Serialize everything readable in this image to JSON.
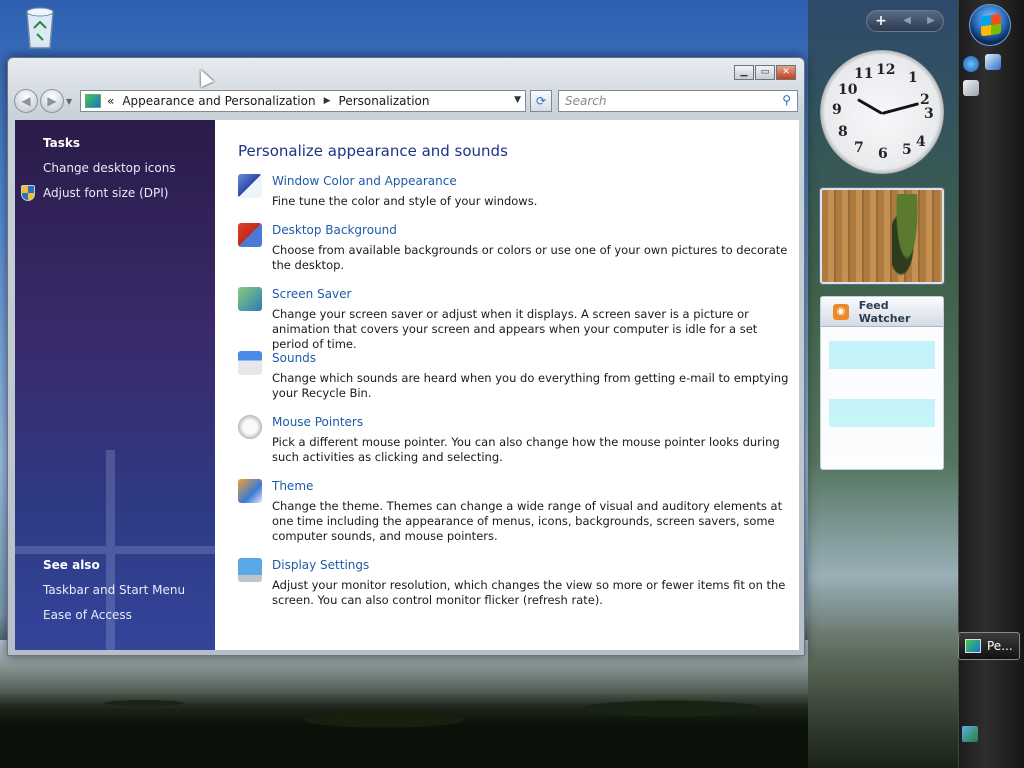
{
  "desktop": {
    "recycle_bin_icon": "recycle-bin-icon"
  },
  "window": {
    "address": {
      "prefix": "«",
      "crumb1": "Appearance and Personalization",
      "crumb2": "Personalization"
    },
    "search_placeholder": "Search",
    "captions": {
      "minimize": "▁",
      "maximize": "▭",
      "close": "✕"
    }
  },
  "left_pane": {
    "tasks_heading": "Tasks",
    "tasks": [
      "Change desktop icons",
      "Adjust font size (DPI)"
    ],
    "see_also_heading": "See also",
    "see_also": [
      "Taskbar and Start Menu",
      "Ease of Access"
    ]
  },
  "main": {
    "title": "Personalize appearance and sounds",
    "items": [
      {
        "label": "Window Color and Appearance",
        "desc": "Fine tune the color and style of your windows."
      },
      {
        "label": "Desktop Background",
        "desc": "Choose from available backgrounds or colors or use one of your own pictures to decorate the desktop."
      },
      {
        "label": "Screen Saver",
        "desc": "Change your screen saver or adjust when it displays. A screen saver is a picture or animation that covers your screen and appears when your computer is idle for a set period of time."
      },
      {
        "label": "Sounds",
        "desc": "Change which sounds are heard when you do everything from getting e-mail to emptying your Recycle Bin."
      },
      {
        "label": "Mouse Pointers",
        "desc": "Pick a different mouse pointer. You can also change how the mouse pointer looks during such activities as clicking and selecting."
      },
      {
        "label": "Theme",
        "desc": "Change the theme. Themes can change a wide range of visual and auditory elements at one time including the appearance of menus, icons, backgrounds, screen savers, some computer sounds, and mouse pointers."
      },
      {
        "label": "Display Settings",
        "desc": "Adjust your monitor resolution, which changes the view so more or fewer items fit on the screen. You can also control monitor flicker (refresh rate)."
      }
    ]
  },
  "sidebar": {
    "add_label": "+",
    "clock_numbers": [
      "12",
      "1",
      "2",
      "3",
      "4",
      "5",
      "6",
      "7",
      "8",
      "9",
      "10",
      "11"
    ],
    "feed_title": "Feed Watcher"
  },
  "taskbar": {
    "button_label": "Pe..."
  }
}
